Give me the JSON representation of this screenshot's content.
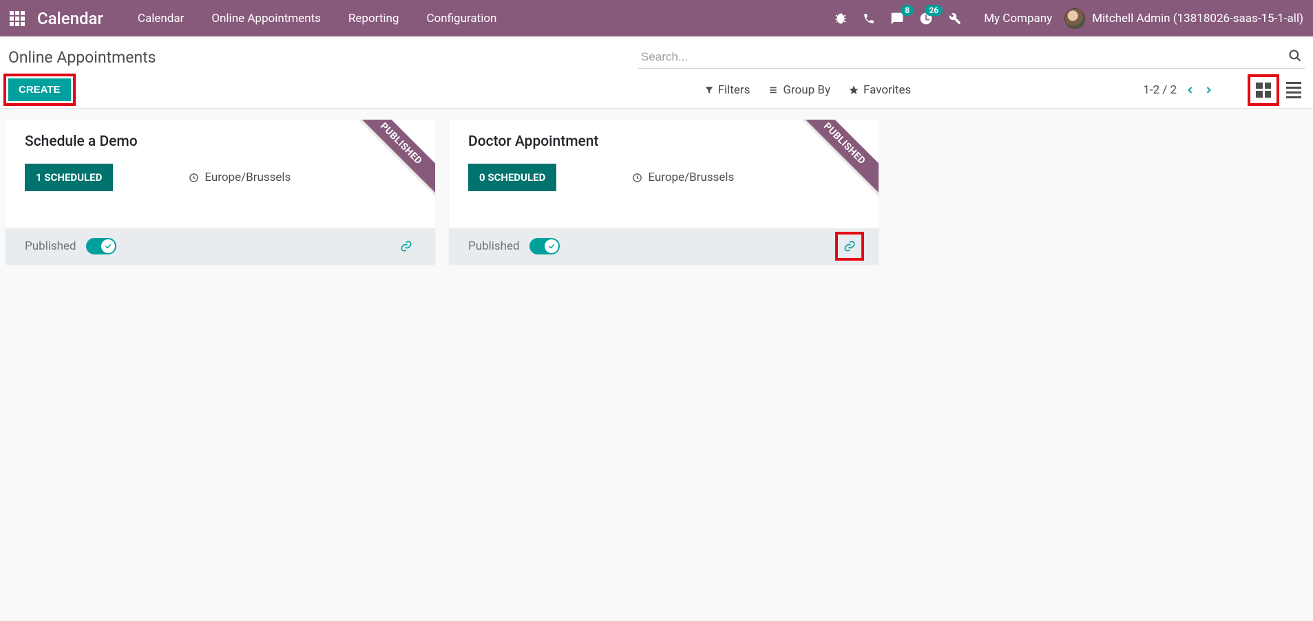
{
  "topbar": {
    "brand": "Calendar",
    "nav": [
      "Calendar",
      "Online Appointments",
      "Reporting",
      "Configuration"
    ],
    "badge_chat": "8",
    "badge_activity": "26",
    "company": "My Company",
    "user": "Mitchell Admin (13818026-saas-15-1-all)"
  },
  "control": {
    "title": "Online Appointments",
    "create": "Create",
    "search_placeholder": "Search...",
    "filters": "Filters",
    "groupby": "Group By",
    "favorites": "Favorites",
    "pager_text": "1-2 / 2"
  },
  "cards": [
    {
      "title": "Schedule a Demo",
      "scheduled_label": "1 Scheduled",
      "timezone": "Europe/Brussels",
      "ribbon": "PUBLISHED",
      "published_label": "Published",
      "highlight_link": false
    },
    {
      "title": "Doctor Appointment",
      "scheduled_label": "0 Scheduled",
      "timezone": "Europe/Brussels",
      "ribbon": "PUBLISHED",
      "published_label": "Published",
      "highlight_link": true
    }
  ],
  "colors": {
    "brand": "#875a7b",
    "teal": "#00a09d",
    "teal_dark": "#00736f",
    "highlight": "#e40613"
  }
}
